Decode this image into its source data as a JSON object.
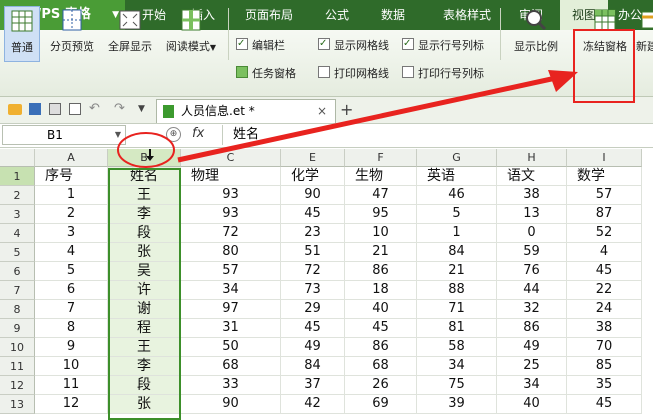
{
  "app": {
    "name": "WPS 表格",
    "logo_letter": "S"
  },
  "menu_tabs": [
    "开始",
    "插入",
    "页面布局",
    "公式",
    "数据",
    "表格样式",
    "审阅",
    "视图",
    "办公"
  ],
  "ribbon": {
    "buttons": {
      "normal": "普通",
      "page_break_preview": "分页预览",
      "full_screen": "全屏显示",
      "reading_mode": "阅读模式",
      "zoom": "显示比例",
      "freeze_panes": "冻结窗格",
      "new_window": "新建"
    },
    "options": {
      "edit_bar": "编辑栏",
      "task_pane": "任务窗格",
      "show_gridlines": "显示网格线",
      "print_gridlines": "打印网格线",
      "show_row_col_headers": "显示行号列标",
      "print_row_col_headers": "打印行号列标"
    }
  },
  "document_tab": {
    "title": "人员信息.et *"
  },
  "formula_bar": {
    "cell_ref": "B1",
    "fx": "fx",
    "content": "姓名"
  },
  "grid": {
    "columns": [
      "A",
      "B",
      "C",
      "E",
      "F",
      "G",
      "H",
      "I"
    ],
    "rows": [
      {
        "num": "1",
        "cells": [
          "序号",
          "姓名",
          "物理",
          "化学",
          "生物",
          "英语",
          "语文",
          "数学"
        ]
      },
      {
        "num": "2",
        "cells": [
          "1",
          "王",
          "93",
          "90",
          "47",
          "46",
          "38",
          "57"
        ]
      },
      {
        "num": "3",
        "cells": [
          "2",
          "李",
          "93",
          "45",
          "95",
          "5",
          "13",
          "87"
        ]
      },
      {
        "num": "4",
        "cells": [
          "3",
          "段",
          "72",
          "23",
          "10",
          "1",
          "0",
          "52"
        ]
      },
      {
        "num": "5",
        "cells": [
          "4",
          "张",
          "80",
          "51",
          "21",
          "84",
          "59",
          "4"
        ]
      },
      {
        "num": "6",
        "cells": [
          "5",
          "吴",
          "57",
          "72",
          "86",
          "21",
          "76",
          "45"
        ]
      },
      {
        "num": "7",
        "cells": [
          "6",
          "许",
          "34",
          "73",
          "18",
          "88",
          "44",
          "22"
        ]
      },
      {
        "num": "8",
        "cells": [
          "7",
          "谢",
          "97",
          "29",
          "40",
          "71",
          "32",
          "24"
        ]
      },
      {
        "num": "9",
        "cells": [
          "8",
          "程",
          "31",
          "45",
          "45",
          "81",
          "86",
          "38"
        ]
      },
      {
        "num": "10",
        "cells": [
          "9",
          "王",
          "50",
          "49",
          "86",
          "58",
          "49",
          "70"
        ]
      },
      {
        "num": "11",
        "cells": [
          "10",
          "李",
          "68",
          "84",
          "68",
          "34",
          "25",
          "85"
        ]
      },
      {
        "num": "12",
        "cells": [
          "11",
          "段",
          "33",
          "37",
          "26",
          "75",
          "34",
          "35"
        ]
      },
      {
        "num": "13",
        "cells": [
          "12",
          "张",
          "90",
          "42",
          "69",
          "39",
          "40",
          "45"
        ]
      }
    ]
  },
  "colors": {
    "accent_green": "#3c8f2a",
    "annotation_red": "#e8231f"
  }
}
